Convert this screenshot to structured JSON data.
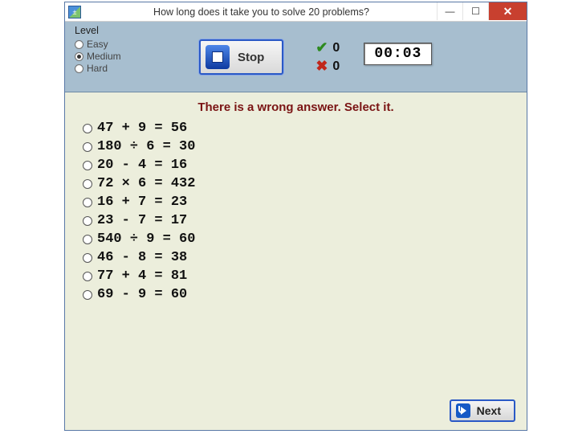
{
  "window": {
    "title": "How long does it take you to solve 20 problems?"
  },
  "level": {
    "legend": "Level",
    "options": [
      "Easy",
      "Medium",
      "Hard"
    ],
    "selected": "Medium"
  },
  "stop": {
    "label": "Stop"
  },
  "score": {
    "correct": "0",
    "wrong": "0"
  },
  "timer": {
    "value": "00:03"
  },
  "instruction": "There is a wrong answer. Select it.",
  "problems": [
    "47 + 9 = 56",
    "180 ÷ 6 = 30",
    "20 - 4 = 16",
    "72 × 6 = 432",
    "16 + 7 = 23",
    "23 - 7 = 17",
    "540 ÷ 9 = 60",
    "46 - 8 = 38",
    "77 + 4 = 81",
    "69 - 9 = 60"
  ],
  "next": {
    "label": "Next"
  }
}
